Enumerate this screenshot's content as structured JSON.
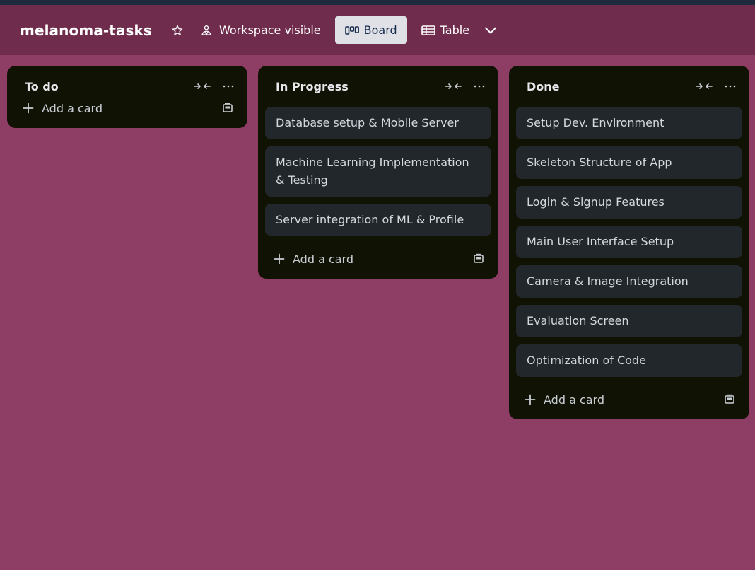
{
  "header": {
    "board_title": "melanoma-tasks",
    "star_icon": "star-icon",
    "visibility_label": "Workspace visible",
    "views": [
      {
        "label": "Board",
        "icon": "board-icon",
        "active": true
      },
      {
        "label": "Table",
        "icon": "table-icon",
        "active": false
      }
    ],
    "more_views_icon": "chevron-down-icon"
  },
  "colors": {
    "board_background": "#8e3e65",
    "header_background": "#6f2c4c",
    "list_background": "#101204",
    "card_background": "#22272b"
  },
  "lists": [
    {
      "title": "To do",
      "cards": [],
      "add_card_label": "Add a card"
    },
    {
      "title": "In Progress",
      "cards": [
        "Database setup & Mobile Server",
        "Machine Learning Implementation & Testing",
        "Server integration of ML & Profile"
      ],
      "add_card_label": "Add a card"
    },
    {
      "title": "Done",
      "cards": [
        "Setup Dev. Environment",
        "Skeleton Structure of App",
        "Login & Signup Features",
        "Main User Interface Setup",
        "Camera & Image Integration",
        "Evaluation Screen",
        "Optimization of Code"
      ],
      "add_card_label": "Add a card"
    }
  ]
}
